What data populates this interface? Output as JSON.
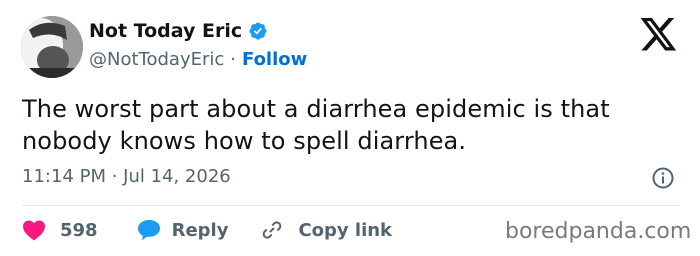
{
  "author": {
    "display_name": "Not Today Eric",
    "handle": "@NotTodayEric",
    "separator": "·",
    "follow_label": "Follow"
  },
  "tweet": {
    "text": "The worst part about a diarrhea epidemic is that nobody knows how to spell diarrhea.",
    "timestamp": "11:14 PM · Jul 14, 2026"
  },
  "actions": {
    "like_count": "598",
    "reply_label": "Reply",
    "copy_link_label": "Copy link"
  },
  "watermark": "boredpanda.com",
  "colors": {
    "verified": "#1d9bf0",
    "follow": "#006fd6",
    "heart": "#f91880",
    "reply_bubble": "#1d9bf0",
    "muted": "#536471"
  },
  "icons": [
    "verified-badge-icon",
    "x-logo-icon",
    "info-icon",
    "heart-icon",
    "speech-bubble-icon",
    "link-icon"
  ]
}
